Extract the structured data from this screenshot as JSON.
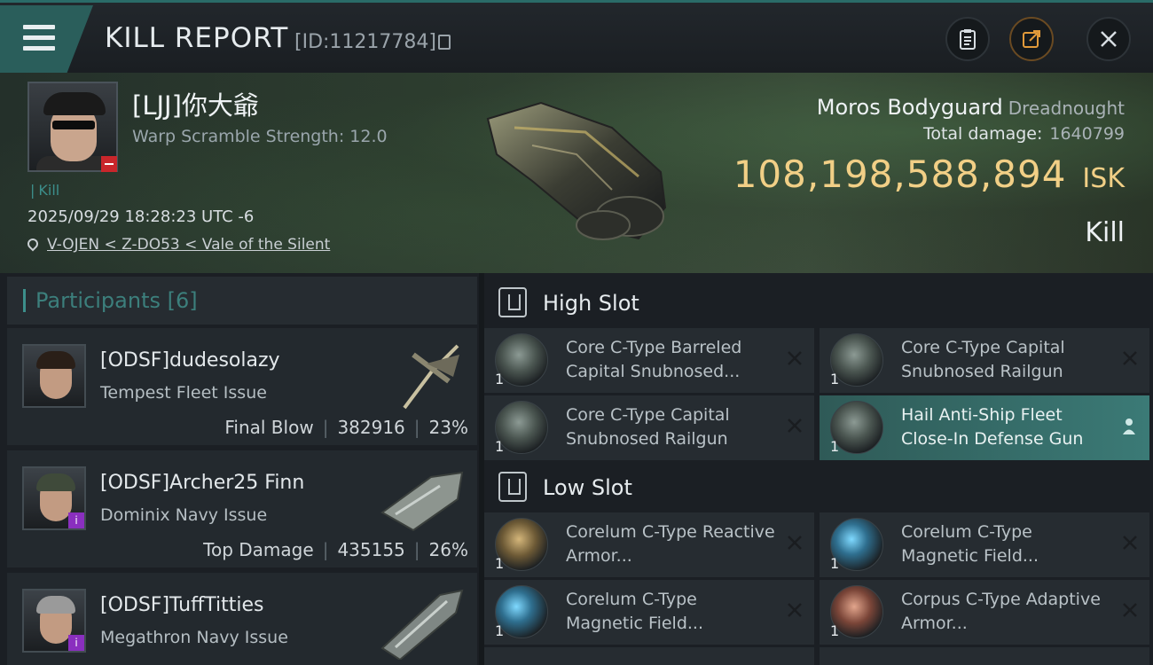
{
  "header": {
    "title": "KILL REPORT",
    "id_text": "[ID:11217784]"
  },
  "victim": {
    "name": "[LJJ]你大爺",
    "warp_scramble": "Warp Scramble Strength: 12.0",
    "kill_tag": "Kill",
    "datetime": "2025/09/29 18:28:23 UTC -6",
    "location": "V-OJEN < Z-DO53 < Vale of the Silent"
  },
  "ship": {
    "name": "Moros Bodyguard",
    "class": "Dreadnought",
    "damage_label": "Total damage:",
    "damage_value": "1640799",
    "isk_value": "108,198,588,894",
    "isk_unit": "ISK",
    "kind": "Kill"
  },
  "participants": {
    "title": "Participants [6]",
    "items": [
      {
        "name": "[ODSF]dudesolazy",
        "ship": "Tempest Fleet Issue",
        "role": "Final Blow",
        "damage": "382916",
        "percent": "23%"
      },
      {
        "name": "[ODSF]Archer25 Finn",
        "ship": "Dominix Navy Issue",
        "role": "Top Damage",
        "damage": "435155",
        "percent": "26%",
        "badge": "i"
      },
      {
        "name": "[ODSF]TuffTitties",
        "ship": "Megathron Navy Issue",
        "role": "",
        "damage": "",
        "percent": "",
        "badge": "i"
      }
    ]
  },
  "slots": {
    "high": {
      "title": "High Slot",
      "items": [
        {
          "label": "Core C-Type Barreled Capital Snubnosed...",
          "qty": "1"
        },
        {
          "label": "Core C-Type Capital Snubnosed Railgun",
          "qty": "1"
        },
        {
          "label": "Core C-Type Capital Snubnosed Railgun",
          "qty": "1"
        },
        {
          "label": "Hail Anti-Ship Fleet Close-In Defense Gun",
          "qty": "1"
        }
      ]
    },
    "low": {
      "title": "Low Slot",
      "items": [
        {
          "label": "Corelum C-Type Reactive Armor...",
          "qty": "1"
        },
        {
          "label": "Corelum C-Type Magnetic Field...",
          "qty": "1"
        },
        {
          "label": "Corelum C-Type Magnetic Field...",
          "qty": "1"
        },
        {
          "label": "Corpus C-Type Adaptive Armor...",
          "qty": "1"
        }
      ]
    }
  },
  "colors": {
    "accent_teal": "#3c8f8b",
    "isk_gold": "#f1cf86",
    "highlight_row": "#3b7a76",
    "destroyed_red": "#c9262b",
    "badge_purple": "#8a2fbf"
  },
  "icons": [
    "menu-icon",
    "copy-icon",
    "clipboard-icon",
    "share-icon",
    "close-icon",
    "location-pin-icon",
    "high-slot-icon",
    "low-slot-icon",
    "remove-x-icon",
    "person-icon"
  ]
}
